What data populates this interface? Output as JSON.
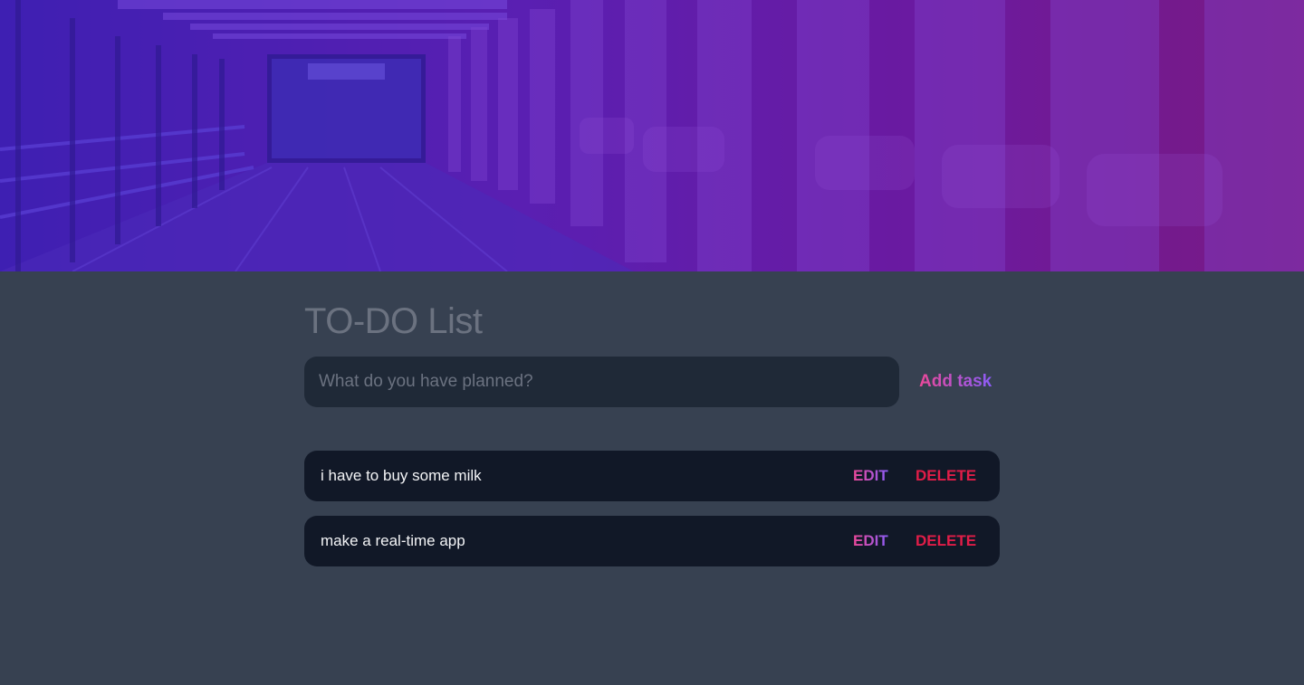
{
  "header": {
    "title": "TO-DO List"
  },
  "new_task": {
    "placeholder": "What do you have planned?",
    "value": "",
    "add_label": "Add task"
  },
  "tasks": [
    {
      "text": "i have to buy some milk",
      "edit_label": "EDIT",
      "delete_label": "DELETE"
    },
    {
      "text": "make a real-time app",
      "edit_label": "EDIT",
      "delete_label": "DELETE"
    }
  ],
  "colors": {
    "background": "#374151",
    "input_background": "#1f2937",
    "task_background": "#111827",
    "accent_gradient_start": "#ec4899",
    "accent_gradient_end": "#8b5cf6",
    "delete": "#e11d48",
    "title": "#6b7280"
  }
}
